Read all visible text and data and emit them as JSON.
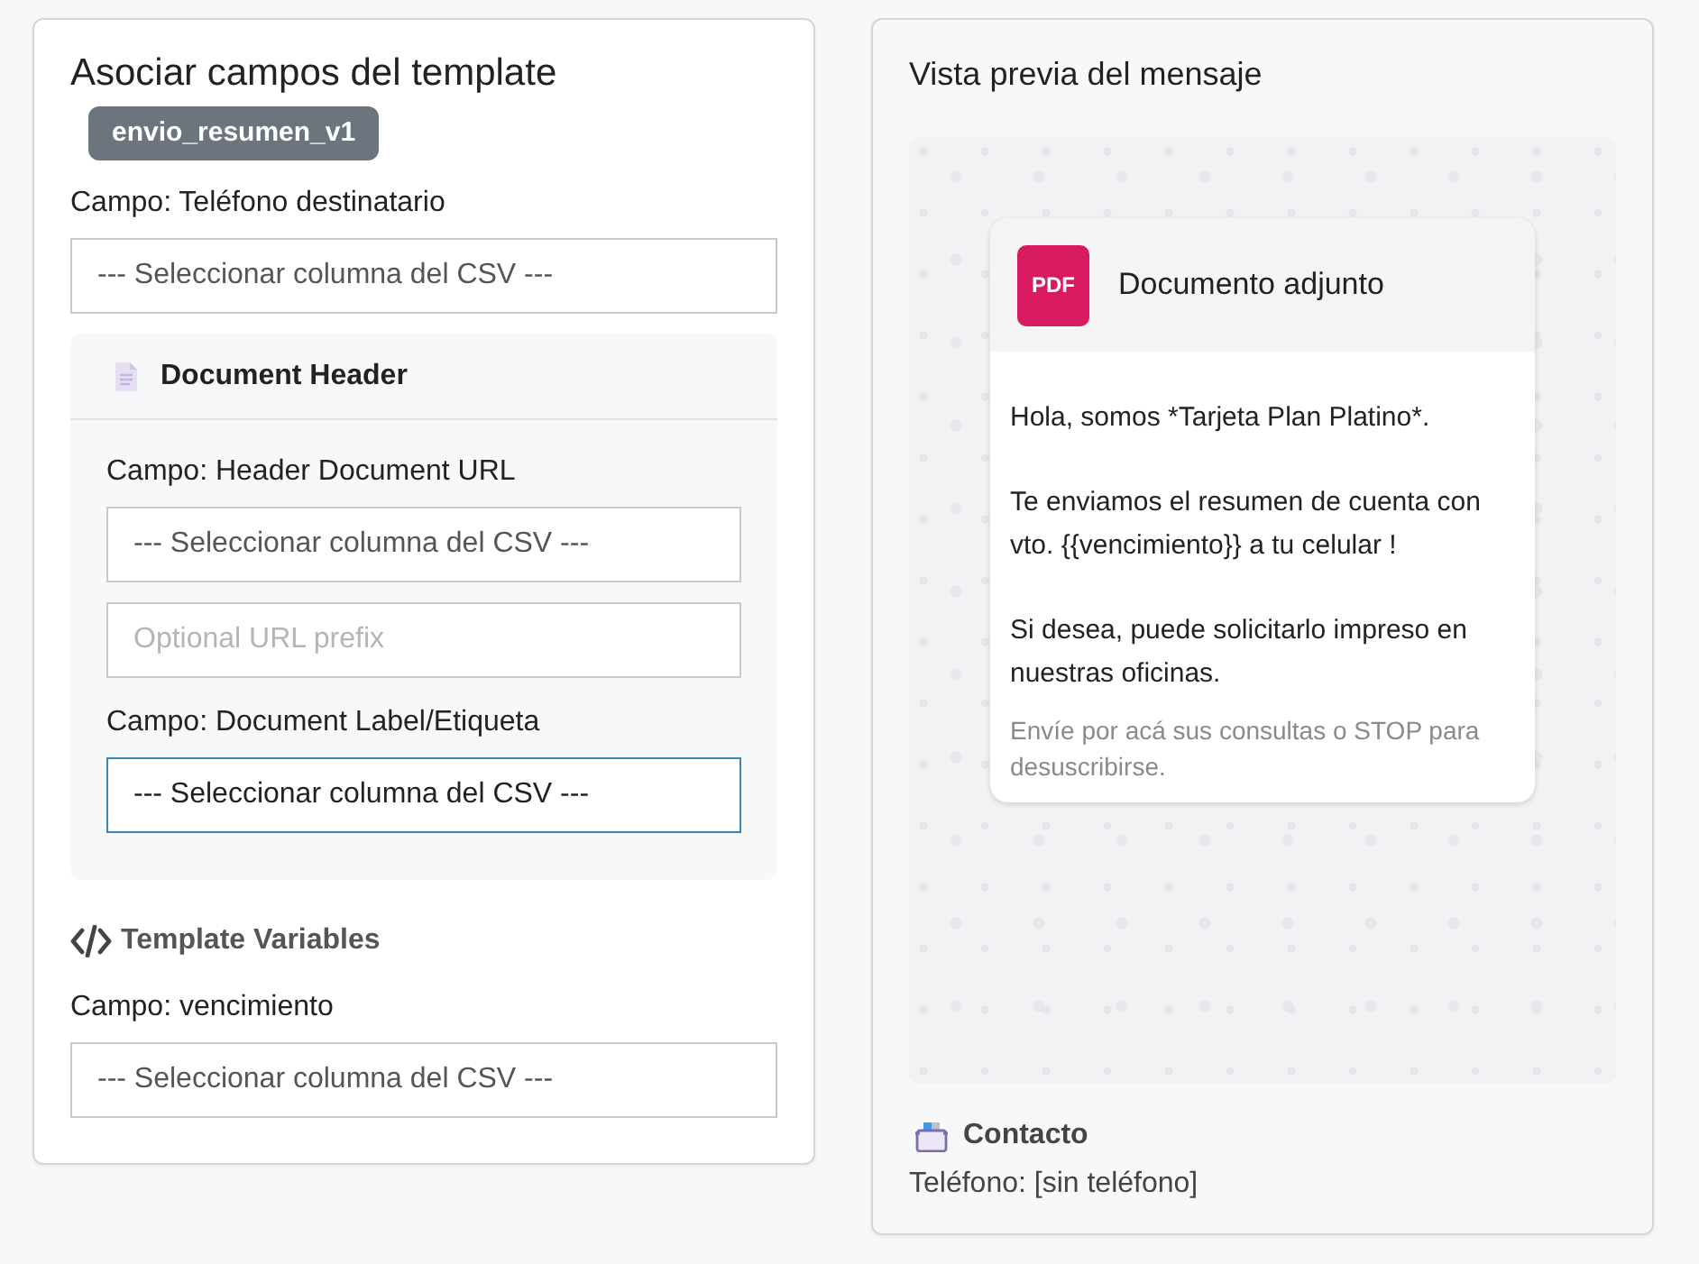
{
  "mapping_panel": {
    "title": "Asociar campos del template",
    "template_badge": "envio_resumen_v1",
    "fields": [
      {
        "label": "Campo: Teléfono destinatario",
        "controls": [
          {
            "kind": "select",
            "value": "--- Seleccionar columna del CSV ---",
            "focused": false
          }
        ]
      }
    ],
    "document_header": {
      "title": "Document Header",
      "fields": [
        {
          "label": "Campo: Header Document URL",
          "controls": [
            {
              "kind": "select",
              "value": "--- Seleccionar columna del CSV ---",
              "focused": false
            },
            {
              "kind": "text_input",
              "placeholder": "Optional URL prefix",
              "focused": false
            }
          ]
        },
        {
          "label": "Campo: Document Label/Etiqueta",
          "controls": [
            {
              "kind": "select",
              "value": "--- Seleccionar columna del CSV ---",
              "focused": true
            }
          ]
        }
      ]
    },
    "template_variables": {
      "title": "Template Variables",
      "fields": [
        {
          "label": "Campo: vencimiento",
          "controls": [
            {
              "kind": "select",
              "value": "--- Seleccionar columna del CSV ---",
              "focused": false
            }
          ]
        }
      ]
    }
  },
  "preview_panel": {
    "title": "Vista previa del mensaje",
    "message": {
      "attachment": {
        "file_type": "PDF",
        "name": "Documento adjunto"
      },
      "paragraphs": [
        "Hola, somos *Tarjeta Plan Platino*.",
        "Te enviamos el resumen de cuenta con vto. {{vencimiento}} a tu celular !",
        "Si desea, puede solicitarlo impreso en nuestras oficinas."
      ],
      "footer": "Envíe por acá sus consultas o STOP para desuscribirse."
    },
    "contact": {
      "title": "Contacto",
      "phone": "Teléfono: [sin teléfono]"
    }
  }
}
